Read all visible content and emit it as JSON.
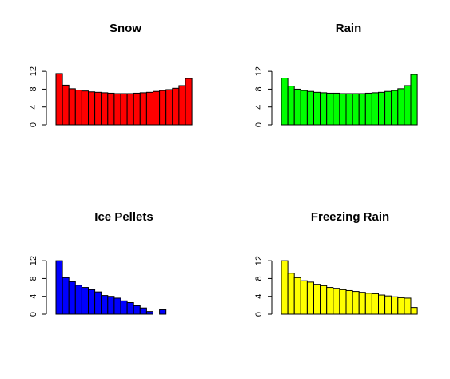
{
  "chart_data": [
    {
      "type": "bar",
      "title": "Snow",
      "color": "#ff0000",
      "ylim": [
        0,
        14
      ],
      "y_ticks": [
        0,
        4,
        8,
        12
      ],
      "values": [
        11.5,
        8.9,
        8.1,
        7.8,
        7.6,
        7.4,
        7.3,
        7.2,
        7.1,
        7.0,
        7.0,
        7.0,
        7.1,
        7.2,
        7.3,
        7.5,
        7.7,
        7.9,
        8.2,
        8.8,
        10.4
      ]
    },
    {
      "type": "bar",
      "title": "Rain",
      "color": "#00ff00",
      "ylim": [
        0,
        14
      ],
      "y_ticks": [
        0,
        4,
        8,
        12
      ],
      "values": [
        10.5,
        8.7,
        8.0,
        7.7,
        7.5,
        7.3,
        7.2,
        7.1,
        7.1,
        7.0,
        7.0,
        7.0,
        7.0,
        7.1,
        7.2,
        7.3,
        7.5,
        7.7,
        8.1,
        8.8,
        11.3
      ]
    },
    {
      "type": "bar",
      "title": "Ice Pellets",
      "color": "#0000ff",
      "ylim": [
        0,
        14
      ],
      "y_ticks": [
        0,
        4,
        8,
        12
      ],
      "values": [
        12.0,
        8.2,
        7.3,
        6.5,
        6.0,
        5.5,
        5.0,
        4.2,
        4.0,
        3.6,
        3.0,
        2.6,
        1.9,
        1.4,
        0.6,
        0.0,
        1.0
      ]
    },
    {
      "type": "bar",
      "title": "Freezing Rain",
      "color": "#ffff00",
      "ylim": [
        0,
        14
      ],
      "y_ticks": [
        0,
        4,
        8,
        12
      ],
      "values": [
        12.0,
        9.2,
        8.2,
        7.5,
        7.2,
        6.7,
        6.4,
        6.0,
        5.8,
        5.5,
        5.3,
        5.1,
        4.9,
        4.7,
        4.6,
        4.3,
        4.1,
        3.9,
        3.7,
        3.6,
        1.5
      ]
    }
  ]
}
